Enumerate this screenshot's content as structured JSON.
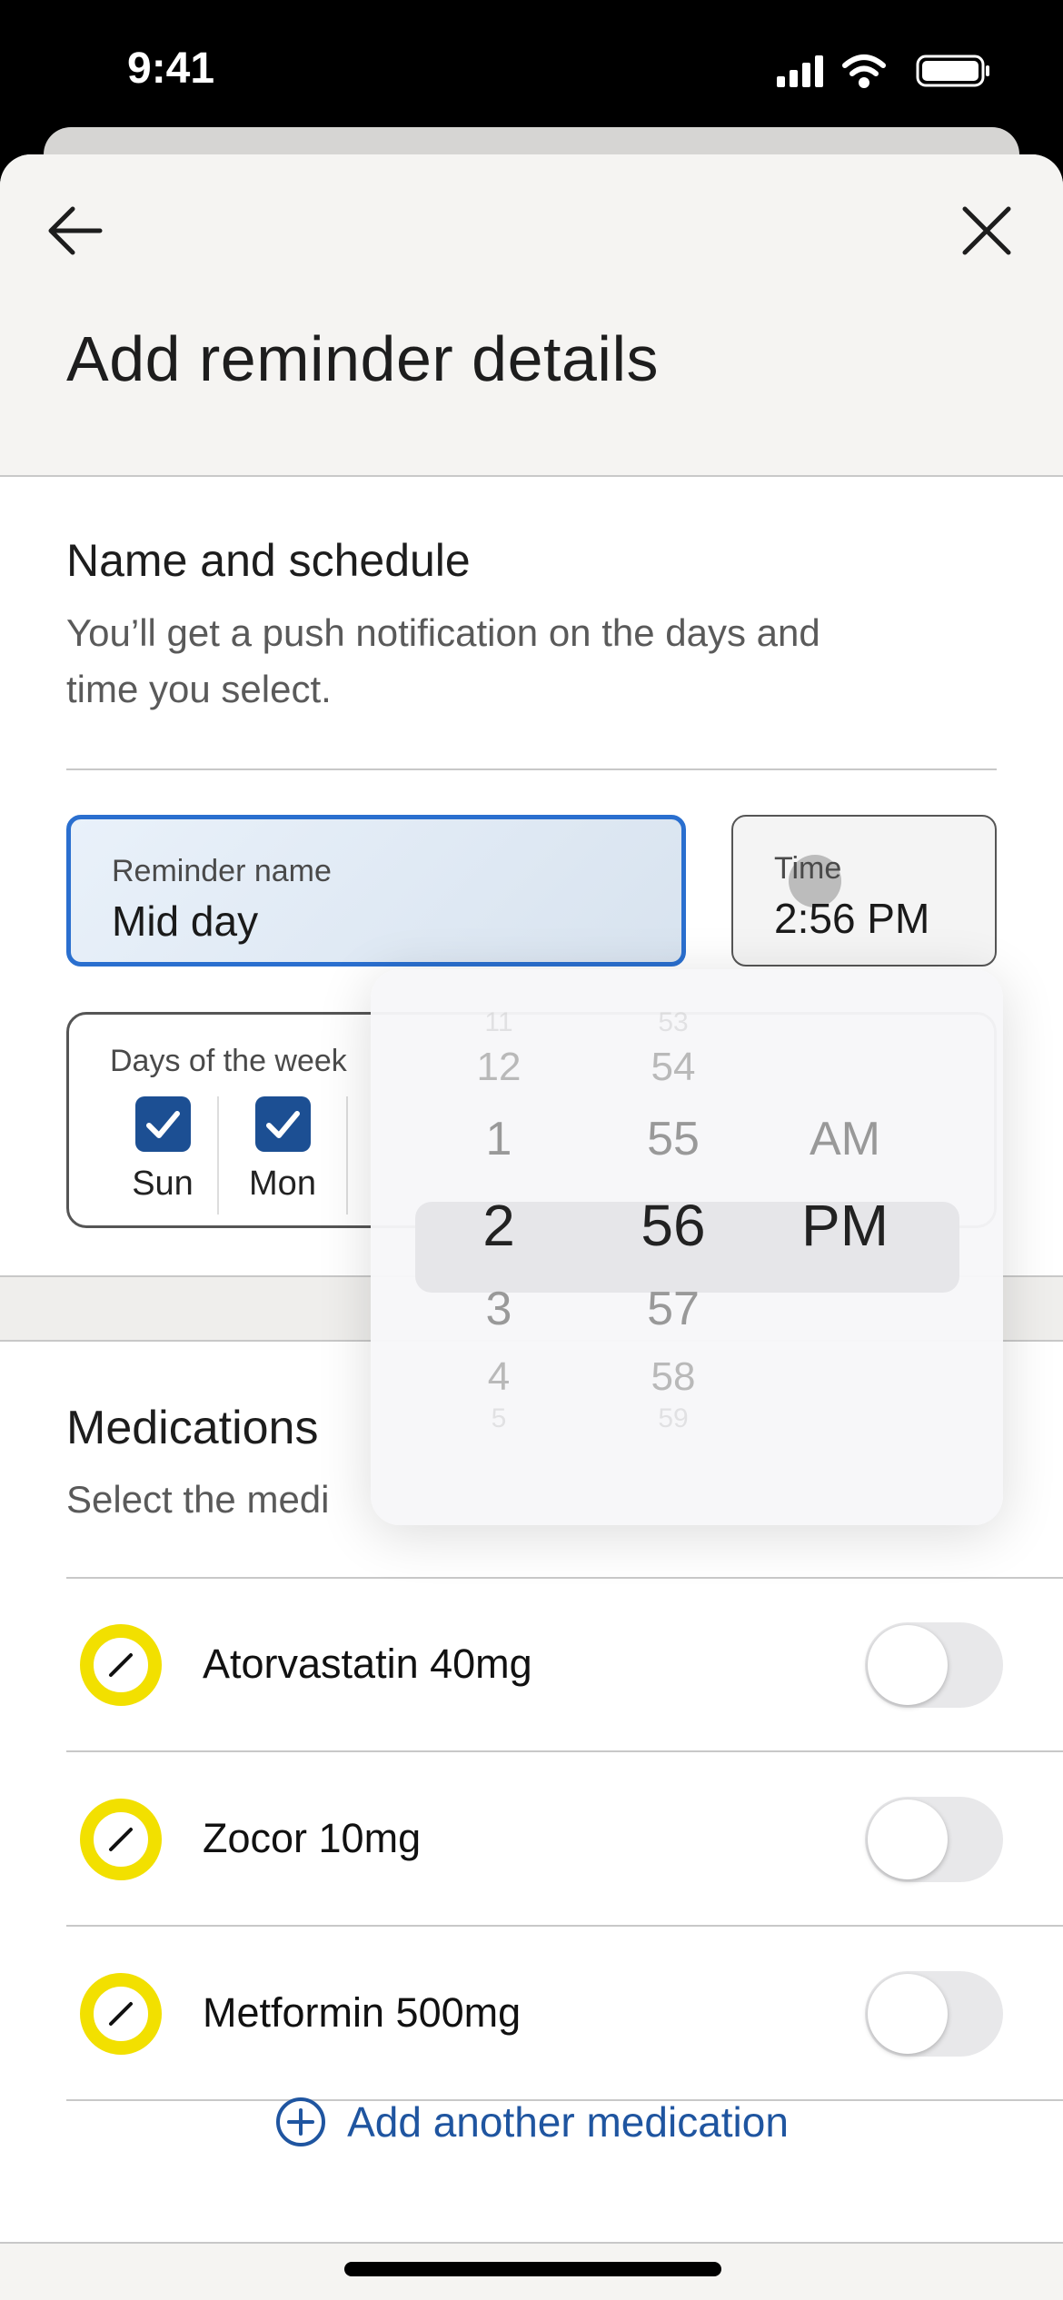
{
  "status_bar": {
    "time": "9:41",
    "icons": [
      "cellular-signal-icon",
      "wifi-icon",
      "battery-icon"
    ]
  },
  "header": {
    "back_icon": "arrow-left-icon",
    "close_icon": "close-icon",
    "title": "Add reminder details"
  },
  "schedule": {
    "heading": "Name and schedule",
    "subtitle_line1": "You’ll get a push notification on the days and",
    "subtitle_line2": "time you select.",
    "reminder_name": {
      "label": "Reminder name",
      "value": "Mid day"
    },
    "time": {
      "label": "Time",
      "value": "2:56 PM"
    },
    "days": {
      "label": "Days of the week",
      "items": [
        {
          "label": "Sun",
          "checked": true
        },
        {
          "label": "Mon",
          "checked": true
        }
      ]
    }
  },
  "medications": {
    "heading": "Medications",
    "subtitle": "Select the medi",
    "items": [
      {
        "name": "Atorvastatin 40mg",
        "enabled": false
      },
      {
        "name": "Zocor 10mg",
        "enabled": false
      },
      {
        "name": "Metformin 500mg",
        "enabled": false
      }
    ],
    "add_label": "Add another medication"
  },
  "time_picker": {
    "hours": [
      "11",
      "12",
      "1",
      "2",
      "3",
      "4",
      "5"
    ],
    "minutes": [
      "53",
      "54",
      "55",
      "56",
      "57",
      "58",
      "59"
    ],
    "periods": [
      "AM",
      "PM"
    ],
    "selected": {
      "hour": "2",
      "minute": "56",
      "period": "PM"
    }
  },
  "colors": {
    "accent_blue": "#2a6fcf",
    "checkbox": "#1c4f93",
    "link": "#1f55a0",
    "pill_ring": "#f2e000"
  }
}
